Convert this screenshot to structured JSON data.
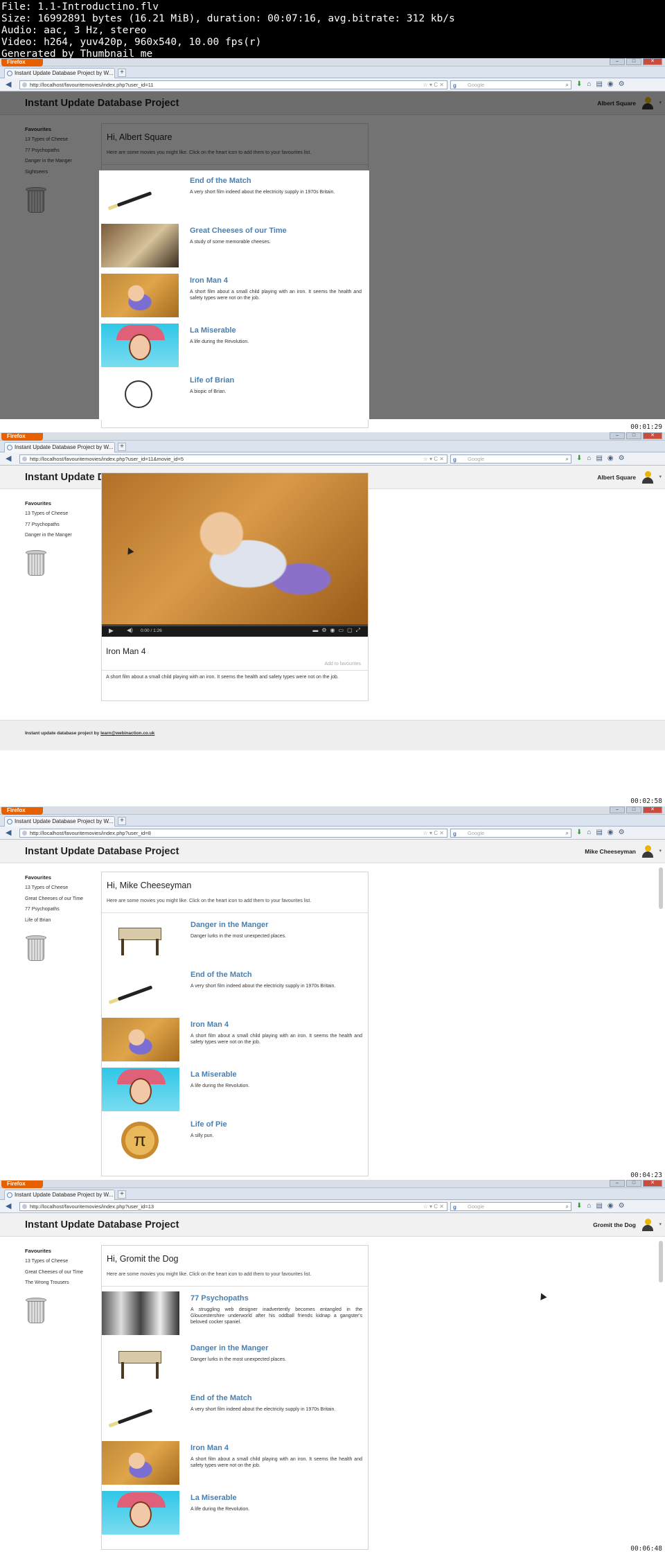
{
  "info": {
    "line1": "File: 1.1-Introductino.flv",
    "line2": "Size: 16992891 bytes (16.21 MiB), duration: 00:07:16, avg.bitrate: 312 kb/s",
    "line3": "Audio: aac, 3 Hz, stereo",
    "line4": "Video: h264, yuv420p, 960x540, 10.00 fps(r)",
    "line5": "Generated by Thumbnail me"
  },
  "browser": {
    "menu_label": "Firefox",
    "tab_title": "Instant Update Database Project by W...",
    "search_placeholder": "Google"
  },
  "site": {
    "title": "Instant Update Database Project",
    "favourites_heading": "Favourites",
    "intro": "Here are some movies you might like. Click on the heart icon to add them to your favourites list.",
    "footer_text": "Instant update database project by ",
    "footer_email": "learn@webinaction.co.uk"
  },
  "frame1": {
    "url": "http://localhost/favouritemovies/index.php?user_id=11",
    "user": "Albert Square",
    "greeting": "Hi, Albert Square",
    "favourites": [
      "13 Types of Cheese",
      "77 Psychopaths",
      "Danger in the Manger",
      "Sightseers"
    ],
    "movies": [
      {
        "title": "End of the Match",
        "desc": "A very short film indeed about the electricity supply in 1970s Britain."
      },
      {
        "title": "Great Cheeses of our Time",
        "desc": "A study of some memorable cheeses."
      },
      {
        "title": "Iron Man 4",
        "desc": "A short film about a small child playing with an iron. It seems the health and safety types were not on the job."
      },
      {
        "title": "La Miserable",
        "desc": "A life during the Revolution."
      },
      {
        "title": "Life of Brian",
        "desc": "A biopic of Brian."
      }
    ],
    "timestamp": "00:01:29"
  },
  "frame2": {
    "url": "http://localhost/favouritemovies/index.php?user_id=11&movie_id=5",
    "user": "Albert Square",
    "favourites": [
      "13 Types of Cheese",
      "77 Psychopaths",
      "Danger in the Manger"
    ],
    "video_time": "0:00 / 1:26",
    "video_progress": 0,
    "movie_title": "Iron Man 4",
    "add_label": "Add to favourites",
    "movie_desc": "A short film about a small child playing with an iron. It seems the health and safety types were not on the job.",
    "timestamp": "00:02:58"
  },
  "frame3": {
    "url": "http://localhost/favouritemovies/index.php?user_id=8",
    "user": "Mike Cheeseyman",
    "greeting": "Hi, Mike Cheeseyman",
    "favourites": [
      "13 Types of Cheese",
      "Great Cheeses of our Time",
      "77 Psychopaths",
      "Life of Brian"
    ],
    "movies": [
      {
        "title": "Danger in the Manger",
        "desc": "Danger lurks in the most unexpected places."
      },
      {
        "title": "End of the Match",
        "desc": "A very short film indeed about the electricity supply in 1970s Britain."
      },
      {
        "title": "Iron Man 4",
        "desc": "A short film about a small child playing with an iron. It seems the health and safety types were not on the job."
      },
      {
        "title": "La Miserable",
        "desc": "A life during the Revolution."
      },
      {
        "title": "Life of Pie",
        "desc": "A silly pun."
      }
    ],
    "timestamp": "00:04:23"
  },
  "frame4": {
    "url": "http://localhost/favouritemovies/index.php?user_id=13",
    "user": "Gromit the Dog",
    "greeting": "Hi, Gromit the Dog",
    "favourites": [
      "13 Types of Cheese",
      "Great Cheeses of our Time",
      "The Wrong Trousers"
    ],
    "movies": [
      {
        "title": "77 Psychopaths",
        "desc": "A struggling web designer inadvertently becomes entangled in the Gloucestershire underworld after his oddball friends kidnap a gangster's beloved cocker spaniel."
      },
      {
        "title": "Danger in the Manger",
        "desc": "Danger lurks in the most unexpected places."
      },
      {
        "title": "End of the Match",
        "desc": "A very short film indeed about the electricity supply in 1970s Britain."
      },
      {
        "title": "Iron Man 4",
        "desc": "A short film about a small child playing with an iron. It seems the health and safety types were not on the job."
      },
      {
        "title": "La Miserable",
        "desc": "A life during the Revolution."
      }
    ],
    "timestamp": "00:06:48"
  },
  "colors": {
    "accent": "#4a7fb0",
    "firefox": "#e66000"
  }
}
